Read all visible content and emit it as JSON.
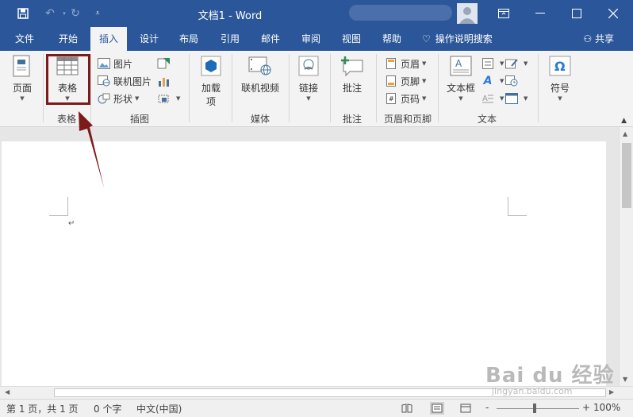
{
  "titlebar": {
    "title": "文档1  -  Word",
    "qat": [
      "save-icon",
      "undo-icon",
      "redo-icon",
      "customize-icon"
    ],
    "window_controls": [
      "ribbon-display-icon",
      "minimize-icon",
      "maximize-icon",
      "close-icon"
    ]
  },
  "tabs": [
    {
      "label": "文件",
      "active": false
    },
    {
      "label": "开始",
      "active": false
    },
    {
      "label": "插入",
      "active": true
    },
    {
      "label": "设计",
      "active": false
    },
    {
      "label": "布局",
      "active": false
    },
    {
      "label": "引用",
      "active": false
    },
    {
      "label": "邮件",
      "active": false
    },
    {
      "label": "审阅",
      "active": false
    },
    {
      "label": "视图",
      "active": false
    },
    {
      "label": "帮助",
      "active": false
    }
  ],
  "tell_me": "操作说明搜索",
  "share": "共享",
  "ribbon": {
    "pages": {
      "button": "页面",
      "group": ""
    },
    "tables": {
      "button": "表格",
      "group": "表格"
    },
    "illustrations": {
      "picture": "图片",
      "online_picture": "联机图片",
      "shapes": "形状",
      "group": "插图"
    },
    "addins": {
      "button_line1": "加载",
      "button_line2": "项"
    },
    "media": {
      "button": "联机视频",
      "group": "媒体"
    },
    "links": {
      "button": "链接",
      "group": ""
    },
    "comments": {
      "button": "批注",
      "group": "批注"
    },
    "header_footer": {
      "header": "页眉",
      "footer": "页脚",
      "page_number": "页码",
      "group": "页眉和页脚"
    },
    "text": {
      "textbox": "文本框",
      "group": "文本"
    },
    "symbols": {
      "button": "符号",
      "group": ""
    }
  },
  "statusbar": {
    "page": "第 1 页，共 1 页",
    "words": "0 个字",
    "language": "中文(中国)",
    "zoom": "100%",
    "zoom_minus": "-",
    "zoom_plus": "+"
  },
  "colors": {
    "accent": "#2b579a",
    "highlight": "#7d1a1a"
  },
  "watermark": {
    "logo": "Bai du 经验",
    "url": "jingyan.baidu.com"
  }
}
